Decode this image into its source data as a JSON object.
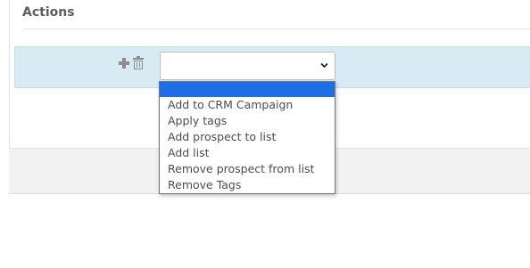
{
  "section": {
    "title": "Actions"
  },
  "action_row": {
    "add_icon": "plus-icon",
    "delete_icon": "trash-icon",
    "select": {
      "selected_value": "",
      "highlighted_option": ""
    }
  },
  "dropdown": {
    "options": [
      "",
      "Add to CRM Campaign",
      "Apply tags",
      "Add prospect to list",
      "Add list",
      "Remove prospect from list",
      "Remove Tags"
    ]
  },
  "colors": {
    "row_background": "#d8ebf5",
    "highlight": "#1e6fe6",
    "footer": "#f2f2f2"
  }
}
